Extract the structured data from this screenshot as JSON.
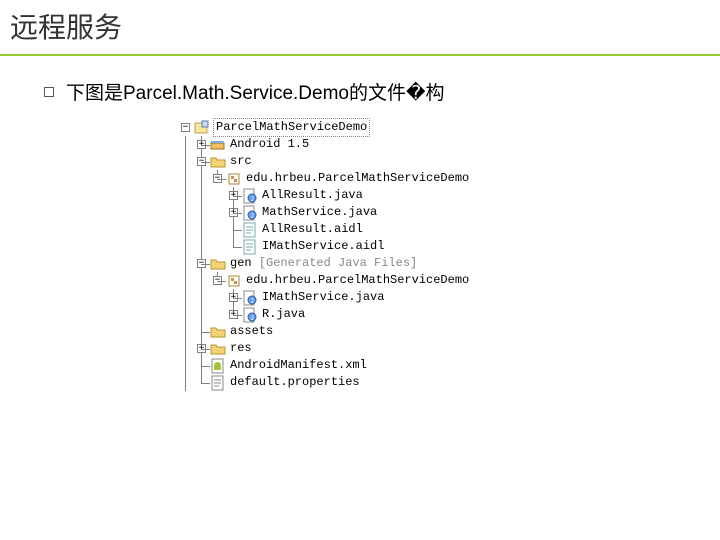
{
  "title": "远程服务",
  "bullet": "下图是Parcel.Math.Service.Demo的文件�构",
  "tree": {
    "root": "ParcelMathServiceDemo",
    "android": "Android 1.5",
    "src": "src",
    "pkg1": "edu.hrbeu.ParcelMathServiceDemo",
    "f1": "AllResult.java",
    "f2": "MathService.java",
    "f3": "AllResult.aidl",
    "f4": "IMathService.aidl",
    "gen": "gen",
    "gen_note": "[Generated Java Files]",
    "pkg2": "edu.hrbeu.ParcelMathServiceDemo",
    "f5": "IMathService.java",
    "f6": "R.java",
    "assets": "assets",
    "res": "res",
    "manifest": "AndroidManifest.xml",
    "default": "default.properties"
  }
}
